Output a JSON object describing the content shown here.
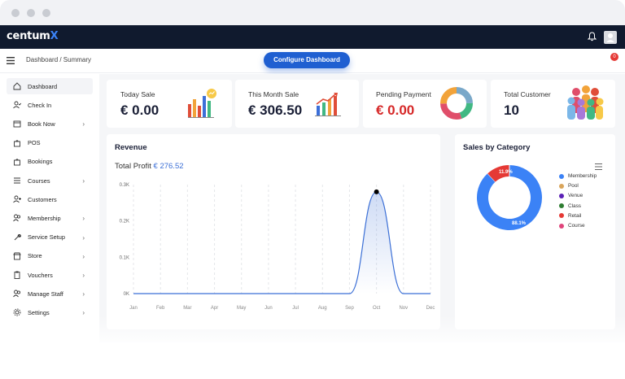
{
  "window": {
    "dots": 3
  },
  "topbar": {
    "logo_text": "centum",
    "logo_accent": "X",
    "brand_color": "#101a2e",
    "accent_color": "#3b82f6"
  },
  "subbar": {
    "breadcrumb": "Dashboard / Summary",
    "configure_label": "Configure Dashboard",
    "cart_count": "0"
  },
  "sidebar": {
    "items": [
      {
        "label": "Dashboard",
        "icon": "home-icon",
        "chevron": false
      },
      {
        "label": "Check In",
        "icon": "user-check-icon",
        "chevron": false
      },
      {
        "label": "Book Now",
        "icon": "calendar-icon",
        "chevron": true
      },
      {
        "label": "POS",
        "icon": "bag-icon",
        "chevron": false
      },
      {
        "label": "Bookings",
        "icon": "bag-icon",
        "chevron": false
      },
      {
        "label": "Courses",
        "icon": "list-icon",
        "chevron": true
      },
      {
        "label": "Customers",
        "icon": "user-add-icon",
        "chevron": false
      },
      {
        "label": "Membership",
        "icon": "users-icon",
        "chevron": true
      },
      {
        "label": "Service Setup",
        "icon": "wrench-icon",
        "chevron": true
      },
      {
        "label": "Store",
        "icon": "store-icon",
        "chevron": true
      },
      {
        "label": "Vouchers",
        "icon": "clipboard-icon",
        "chevron": true
      },
      {
        "label": "Manage Staff",
        "icon": "users-icon",
        "chevron": true
      },
      {
        "label": "Settings",
        "icon": "gear-icon",
        "chevron": true
      }
    ]
  },
  "kpis": [
    {
      "label": "Today Sale",
      "value": "€ 0.00",
      "icon": "bar-chart-icon",
      "negative": false
    },
    {
      "label": "This Month Sale",
      "value": "€ 306.50",
      "icon": "trend-chart-icon",
      "negative": false
    },
    {
      "label": "Pending Payment",
      "value": "€ 0.00",
      "icon": "donut-chart-icon",
      "negative": true
    },
    {
      "label": "Total Customer",
      "value": "10",
      "icon": "people-icon",
      "negative": false
    }
  ],
  "revenue": {
    "title": "Revenue",
    "profit_label": "Total Profit",
    "profit_value": "€ 276.52"
  },
  "category": {
    "title": "Sales by Category",
    "label_small": "11.9%",
    "label_large": "88.1%",
    "legend": [
      {
        "name": "Membership",
        "color": "#3b82f6"
      },
      {
        "name": "Pool",
        "color": "#d9a55b"
      },
      {
        "name": "Venue",
        "color": "#5b21b6"
      },
      {
        "name": "Class",
        "color": "#2e7d32"
      },
      {
        "name": "Retail",
        "color": "#e53935"
      },
      {
        "name": "Course",
        "color": "#e0457b"
      }
    ]
  },
  "chart_data": [
    {
      "type": "area",
      "title": "Revenue",
      "categories": [
        "Jan",
        "Feb",
        "Mar",
        "Apr",
        "May",
        "Jun",
        "Jul",
        "Aug",
        "Sep",
        "Oct",
        "Nov",
        "Dec"
      ],
      "values": [
        0,
        0,
        0,
        0,
        0,
        0,
        0,
        0,
        0,
        2.8,
        0,
        0
      ],
      "y_ticks": [
        "0K",
        "0.1K",
        "0.2K",
        "0.3K"
      ],
      "ylim": [
        0,
        3
      ]
    },
    {
      "type": "pie",
      "title": "Sales by Category",
      "labels": [
        "Membership",
        "Retail"
      ],
      "values": [
        88.1,
        11.9
      ]
    }
  ]
}
